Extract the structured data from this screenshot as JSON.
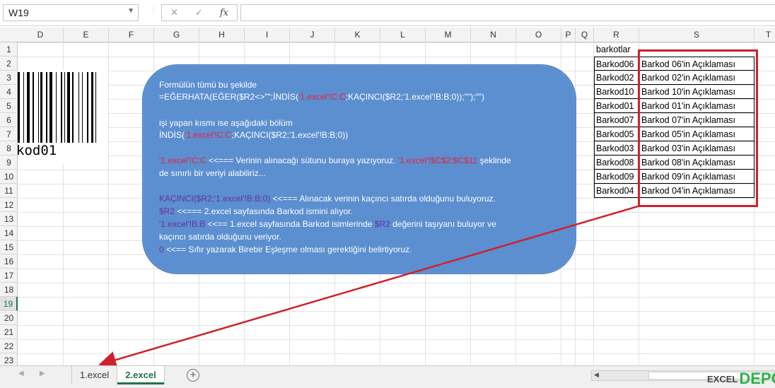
{
  "namebox": {
    "value": "W19"
  },
  "formula_bar": {
    "cancel": "✕",
    "enter": "✓",
    "fx": "fx",
    "content": ""
  },
  "columns": [
    "D",
    "E",
    "F",
    "G",
    "H",
    "I",
    "J",
    "K",
    "L",
    "M",
    "N",
    "O",
    "P",
    "Q",
    "R",
    "S",
    "T"
  ],
  "rows": [
    "1",
    "2",
    "3",
    "4",
    "5",
    "6",
    "7",
    "8",
    "9",
    "10",
    "11",
    "12",
    "13",
    "14",
    "15",
    "16",
    "17",
    "18",
    "19",
    "20",
    "21",
    "22",
    "23"
  ],
  "selected_row": "19",
  "barcode_text": "kod01",
  "callout": {
    "l1": "Formülün tümü bu şekilde",
    "l2": "=EĞERHATA(EĞER($R2<>\"\";İNDİS(",
    "l2r": "'1.excel'!C:C",
    "l2b": ";KAÇINCI($R2;'1.excel'!B:B;0));\"\");\"\")",
    "l3": "işi yapan kısmı ise aşağıdaki bölüm",
    "l4a": "İNDİS(",
    "l4r": "'1.excel'!C:C",
    "l4b": ";KAÇINCI($R2;'1.excel'!B:B;0))",
    "l5r": "'1.excel'!C:C",
    "l5b": "  <<=== Verinin alınacağı sütunu buraya yazıyoruz. ",
    "l5r2": "'1.excel'!$C$2:$C$11",
    "l5c": "  şeklinde",
    "l6": "de sınırlı bir veriyi alabiliriz...",
    "l7p": "KAÇINCI($R2;'1.excel'!B:B;0)",
    "l7b": " <<=== Alınacak verinin kaçıncı satırda olduğunu buluyoruz.",
    "l8p": "$R2",
    "l8b": " <<=== 2.excel sayfasında Barkod ismini alıyor.",
    "l9p": "'1.excel'!B:B",
    "l9b": " <<== 1.excel sayfasında Barkod isimlerinde ",
    "l9p2": "$R2",
    "l9c": " değerini taşıyanı buluyor ve",
    "l10": "kaçıncı satırda olduğunu veriyor.",
    "l11p": "0",
    "l11b": " <<== Sıfır yazarak Birebir Eşleşme olması gerektiğini belirtiyoruz."
  },
  "r_header": "barkotlar",
  "table": [
    {
      "r": "Barkod06",
      "s": "Barkod 06'in Açıklaması"
    },
    {
      "r": "Barkod02",
      "s": "Barkod 02'in Açıklaması"
    },
    {
      "r": "Barkod10",
      "s": "Barkod 10'in Açıklaması"
    },
    {
      "r": "Barkod01",
      "s": "Barkod 01'in Açıklaması"
    },
    {
      "r": "Barkod07",
      "s": "Barkod 07'in Açıklaması"
    },
    {
      "r": "Barkod05",
      "s": "Barkod 05'in Açıklaması"
    },
    {
      "r": "Barkod03",
      "s": "Barkod 03'in Açıklaması"
    },
    {
      "r": "Barkod08",
      "s": "Barkod 08'in Açıklaması"
    },
    {
      "r": "Barkod09",
      "s": "Barkod 09'in Açıklaması"
    },
    {
      "r": "Barkod04",
      "s": "Barkod 04'in Açıklaması"
    }
  ],
  "sheets": [
    "1.excel",
    "2.excel"
  ],
  "active_sheet": "2.excel",
  "add_sheet": "+",
  "logo": {
    "a": "EXCEL",
    "b": "DEPO"
  },
  "colors": {
    "accent": "#217346",
    "callout": "#5b8fd0",
    "annotation_red": "#d0202c"
  }
}
